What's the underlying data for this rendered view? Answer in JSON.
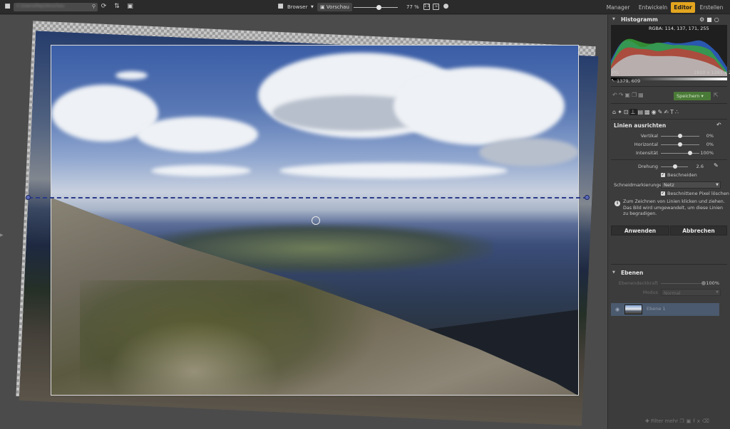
{
  "topbar": {
    "path_text": "C:\\Users\\Pap\\Vorschau",
    "browser_label": "Browser",
    "preview_label": "Vorschau",
    "zoom": "77 %",
    "zoom_level": 0.57,
    "tabs": [
      {
        "label": "Manager",
        "active": false
      },
      {
        "label": "Entwickeln",
        "active": false
      },
      {
        "label": "Editor",
        "active": true
      },
      {
        "label": "Erstellen",
        "active": false
      }
    ],
    "accent_color": "#e3a51f"
  },
  "histogram": {
    "title": "Histogramm",
    "rgba": "RGBA: 114, 137, 171, 255",
    "format": "JPG",
    "dimensions": "1920 x 1281 x 24",
    "cursor_pos": "1379, 609"
  },
  "toolbar": {
    "save_label": "Speichern"
  },
  "straighten": {
    "title": "Linien ausrichten",
    "vertikal_label": "Vertikal",
    "vertikal_value": "0%",
    "vertikal_level": 0.5,
    "horizontal_label": "Horizontal",
    "horizontal_value": "0%",
    "horizontal_level": 0.5,
    "intensitaet_label": "Intensität",
    "intensitaet_value": "100%",
    "intensitaet_level": 0.75,
    "drehung_label": "Drehung",
    "drehung_value": "2.6",
    "drehung_level": 0.52,
    "beschneiden_label": "Beschneiden",
    "schneid_label": "Schneidmarkierungen",
    "schneid_value": "Netz",
    "beschnittene_label": "Beschnittene Pixel löschen",
    "info_text": "Zum Zeichnen von Linien klicken und ziehen. Das Bild wird umgewandelt, um diese Linien zu begradigen.",
    "apply_label": "Anwenden",
    "cancel_label": "Abbrechen"
  },
  "layers": {
    "title": "Ebenen",
    "opacity_label": "Ebenendeckkraft",
    "opacity_value": "100%",
    "mode_label": "Modus",
    "mode_value": "Normal",
    "layer_name": "Ebene 1",
    "bottom_label": "Filter mehr"
  }
}
